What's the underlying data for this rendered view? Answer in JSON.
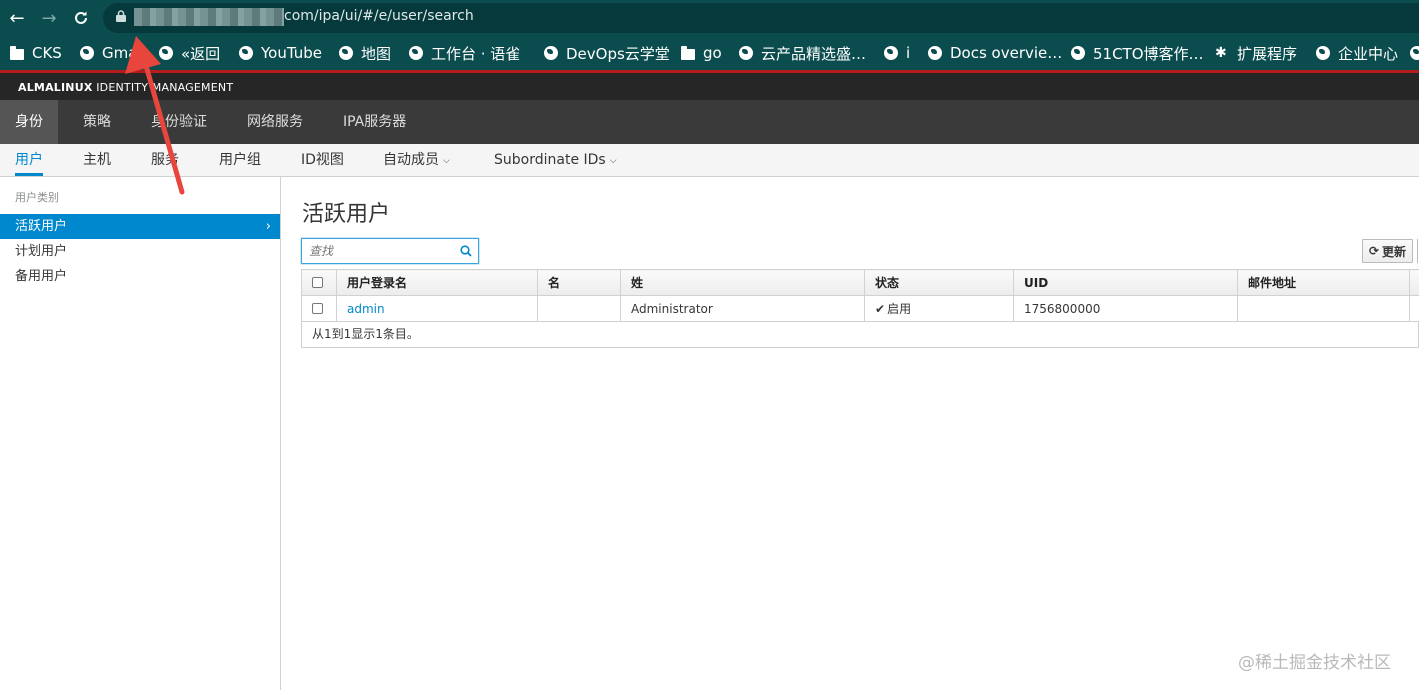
{
  "browser": {
    "url": "com/ipa/ui/#/e/user/search",
    "bookmarks": [
      {
        "icon": "folder-icon",
        "label": "CKS"
      },
      {
        "icon": "globe-icon",
        "label": "Gma"
      },
      {
        "icon": "globe-icon",
        "label": "«返回"
      },
      {
        "icon": "globe-icon",
        "label": "YouTube"
      },
      {
        "icon": "globe-icon",
        "label": "地图"
      },
      {
        "icon": "globe-icon",
        "label": "工作台 · 语雀"
      },
      {
        "icon": "globe-icon",
        "label": "DevOps云学堂"
      },
      {
        "icon": "folder-icon",
        "label": "go"
      },
      {
        "icon": "globe-icon",
        "label": "云产品精选盛…"
      },
      {
        "icon": "globe-icon",
        "label": "i"
      },
      {
        "icon": "globe-icon",
        "label": "Docs overvie…"
      },
      {
        "icon": "globe-icon",
        "label": "51CTO博客作…"
      },
      {
        "icon": "puzzle-icon",
        "label": "扩展程序"
      },
      {
        "icon": "globe-icon",
        "label": "企业中心"
      }
    ]
  },
  "brand": {
    "bold": "ALMALINUX",
    "rest": " IDENTITY MANAGEMENT"
  },
  "topnav": [
    "身份",
    "策略",
    "身份验证",
    "网络服务",
    "IPA服务器"
  ],
  "subnav": [
    {
      "label": "用户",
      "dropdown": false
    },
    {
      "label": "主机",
      "dropdown": false
    },
    {
      "label": "服务",
      "dropdown": false
    },
    {
      "label": "用户组",
      "dropdown": false
    },
    {
      "label": "ID视图",
      "dropdown": false
    },
    {
      "label": "自动成员",
      "dropdown": true
    },
    {
      "label": "Subordinate IDs",
      "dropdown": true
    }
  ],
  "sidebar": {
    "caption": "用户类别",
    "items": [
      "活跃用户",
      "计划用户",
      "备用用户"
    ]
  },
  "main": {
    "title": "活跃用户",
    "search_placeholder": "查找",
    "refresh_label": "更新",
    "columns": [
      "用户登录名",
      "名",
      "姓",
      "状态",
      "UID",
      "邮件地址"
    ],
    "rows": [
      {
        "login": "admin",
        "first": "",
        "last": "Administrator",
        "status": "启用",
        "uid": "1756800000",
        "email": ""
      }
    ],
    "footer": "从1到1显示1条目。"
  },
  "watermark": "@稀土掘金技术社区",
  "colors": {
    "chrome": "#0b4c4e",
    "accent": "#0088ce",
    "annotation_arrow": "#e8453c"
  }
}
